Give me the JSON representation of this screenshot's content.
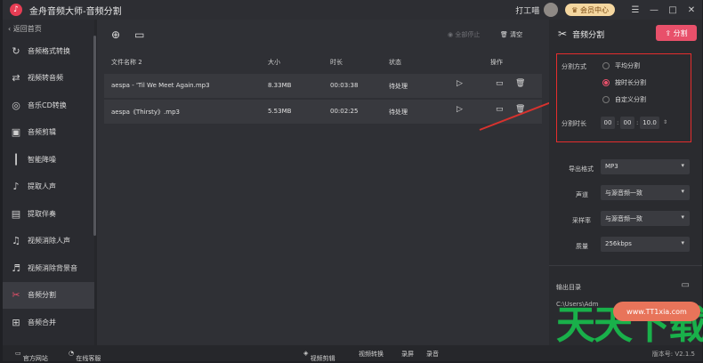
{
  "app": {
    "title": "金舟音频大师-音频分割",
    "user": "打工喵",
    "vip_label": "会员中心"
  },
  "window_controls": [
    "☰",
    "—",
    "□",
    "✕"
  ],
  "sidebar": {
    "back_label": "返回首页",
    "items": [
      {
        "label": "音频格式转换",
        "icon": "audio-convert-icon"
      },
      {
        "label": "视频转音频",
        "icon": "video-to-audio-icon"
      },
      {
        "label": "音乐CD转换",
        "icon": "cd-icon"
      },
      {
        "label": "音频剪辑",
        "icon": "audio-cut-icon"
      },
      {
        "label": "智能降噪",
        "icon": "denoise-icon"
      },
      {
        "label": "提取人声",
        "icon": "vocal-extract-icon"
      },
      {
        "label": "提取伴奏",
        "icon": "accompaniment-icon"
      },
      {
        "label": "视频消除人声",
        "icon": "video-remove-vocal-icon"
      },
      {
        "label": "视频消除背景音",
        "icon": "video-remove-bgm-icon"
      },
      {
        "label": "音频分割",
        "icon": "scissors-icon",
        "active": true
      },
      {
        "label": "音频合并",
        "icon": "merge-icon"
      }
    ]
  },
  "toolbar": {
    "pause_all": "全部停止",
    "clear": "清空"
  },
  "table": {
    "headers": {
      "name": "文件名称 2",
      "size": "大小",
      "duration": "时长",
      "status": "状态",
      "action": "操作"
    },
    "rows": [
      {
        "name": "aespa - 'Til We Meet Again.mp3",
        "size": "8.33MB",
        "duration": "00:03:38",
        "status": "待处理"
      },
      {
        "name": "aespa《Thirsty》.mp3",
        "size": "5.53MB",
        "duration": "00:02:25",
        "status": "待处理"
      }
    ]
  },
  "panel": {
    "title": "音频分割",
    "split_button": "分割",
    "mode_label": "分割方式",
    "modes": [
      "平均分割",
      "按时长分割",
      "自定义分割"
    ],
    "selected_mode": "按时长分割",
    "duration_label": "分割时长",
    "duration": {
      "h": "00",
      "m": "00",
      "s": "10.0"
    },
    "output_format_label": "导出格式",
    "output_format": "MP3",
    "channel_label": "声道",
    "channel": "与源音频一致",
    "sample_rate_label": "采样率",
    "sample_rate": "与源音频一致",
    "quality_label": "质量",
    "quality": "256kbps",
    "output_dir_label": "输出目录",
    "output_path": "C:\\Users\\Adm"
  },
  "statusbar": {
    "website": "官方网站",
    "service": "在线客服",
    "links": [
      "视频剪辑",
      "视频转换",
      "录屏",
      "录音"
    ],
    "version": "版本号: V2.1.5"
  },
  "watermark": {
    "pill": "www.TT1xia.com",
    "text": "天天下载"
  },
  "colors": {
    "accent": "#e8506a",
    "highlight_box": "#e52d2d",
    "watermark_green": "#19b04a"
  }
}
